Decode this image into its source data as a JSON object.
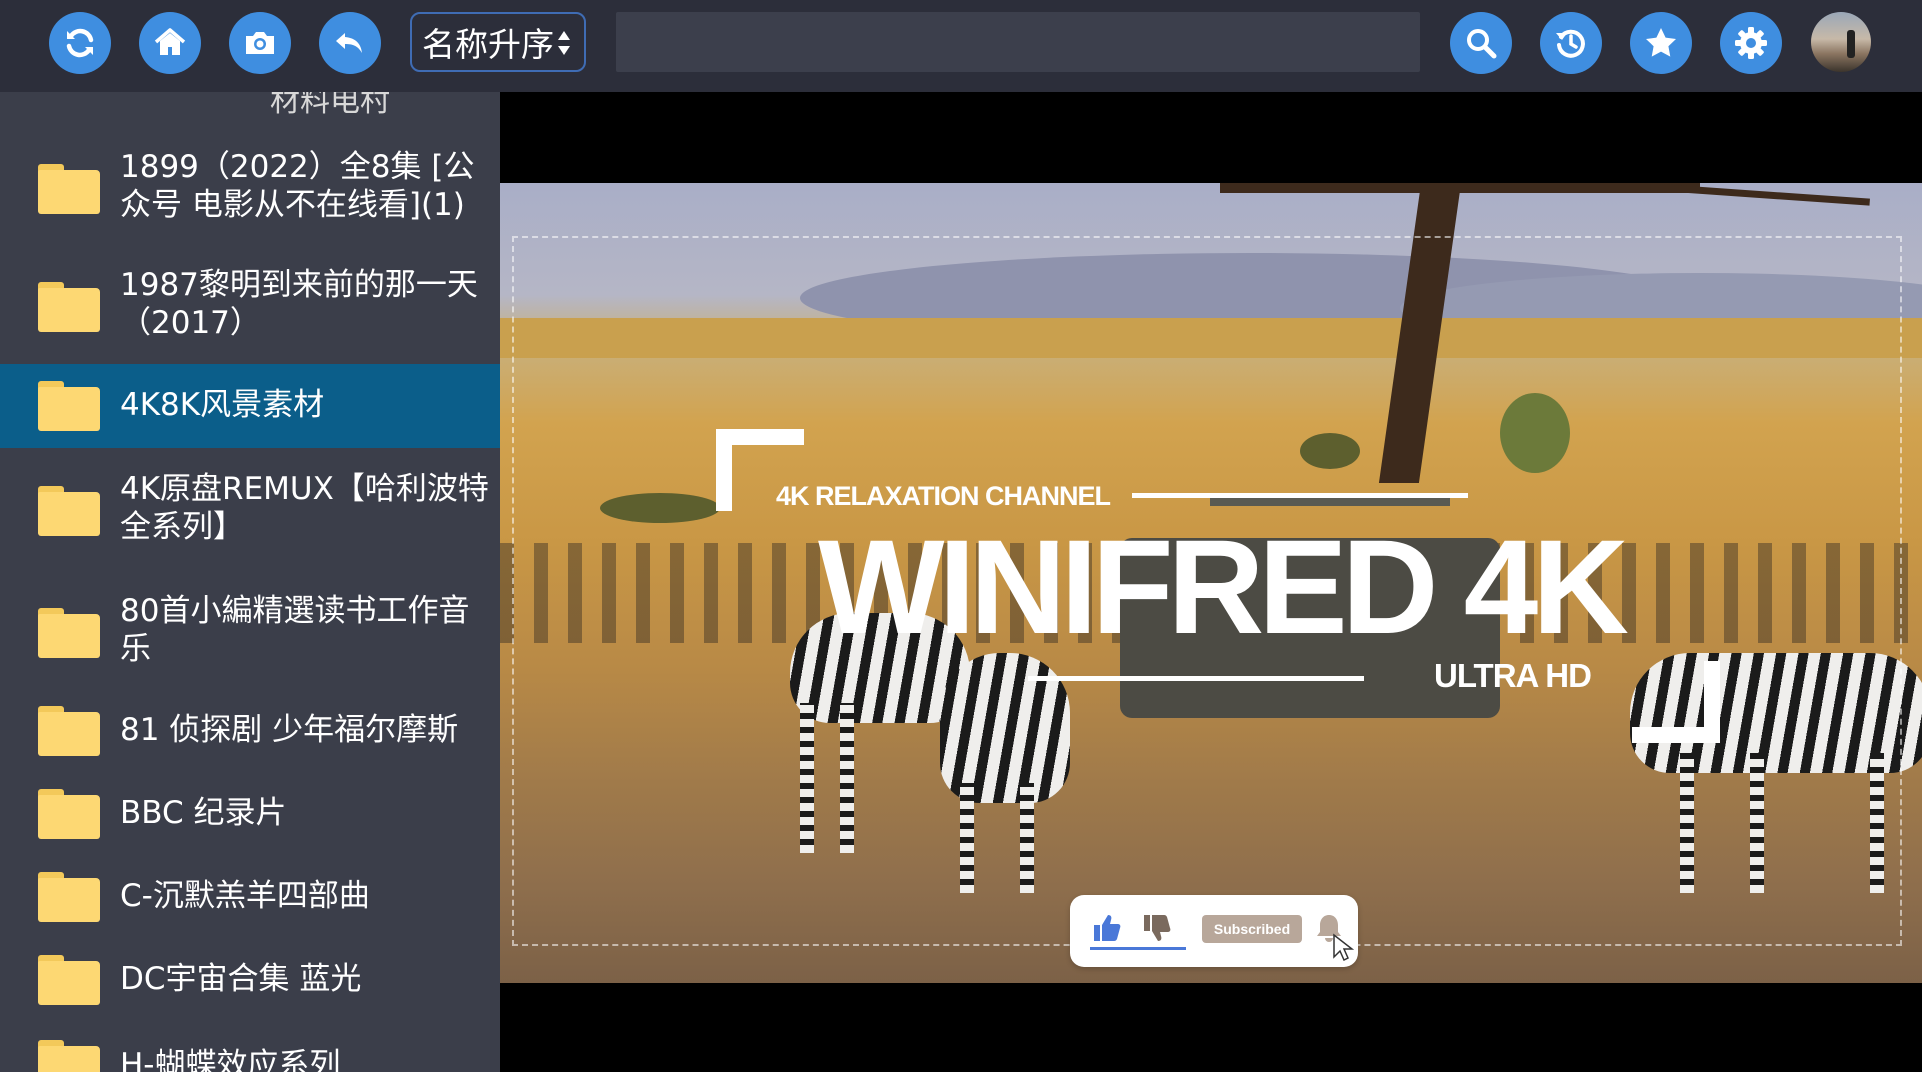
{
  "toolbar": {
    "buttons": [
      {
        "name": "refresh-button",
        "icon": "refresh-icon"
      },
      {
        "name": "home-button",
        "icon": "home-icon"
      },
      {
        "name": "camera-button",
        "icon": "camera-icon"
      },
      {
        "name": "back-button",
        "icon": "undo-icon"
      },
      {
        "name": "search-button",
        "icon": "search-icon"
      },
      {
        "name": "history-button",
        "icon": "history-icon"
      },
      {
        "name": "favorites-button",
        "icon": "star-icon"
      },
      {
        "name": "settings-button",
        "icon": "gear-icon"
      }
    ],
    "sort_label": "名称升序",
    "search_value": "",
    "accent_color": "#3f8ee0"
  },
  "sidebar": {
    "cut_item_text": "材料电村",
    "items": [
      {
        "label": "1899（2022）全8集 [公众号 电影从不在线看](1)",
        "active": false
      },
      {
        "label": "1987黎明到来前的那一天（2017）",
        "active": false
      },
      {
        "label": "4K8K风景素材",
        "active": true
      },
      {
        "label": "4K原盘REMUX【哈利波特全系列】",
        "active": false
      },
      {
        "label": "80首小編精選读书工作音乐",
        "active": false
      },
      {
        "label": "81 侦探剧 少年福尔摩斯",
        "active": false
      },
      {
        "label": "BBC 纪录片",
        "active": false
      },
      {
        "label": "C-沉默羔羊四部曲",
        "active": false
      },
      {
        "label": "DC宇宙合集 蓝光",
        "active": false
      },
      {
        "label": "H-蝴蝶效应系列",
        "active": false
      }
    ],
    "active_color": "#0b5e8a",
    "folder_color": "#fdd873"
  },
  "video": {
    "channel_text": "4K RELAXATION CHANNEL",
    "title_text": "WINIFRED 4K",
    "subtitle_text": "ULTRA HD",
    "subscribe_label": "Subscribed"
  }
}
